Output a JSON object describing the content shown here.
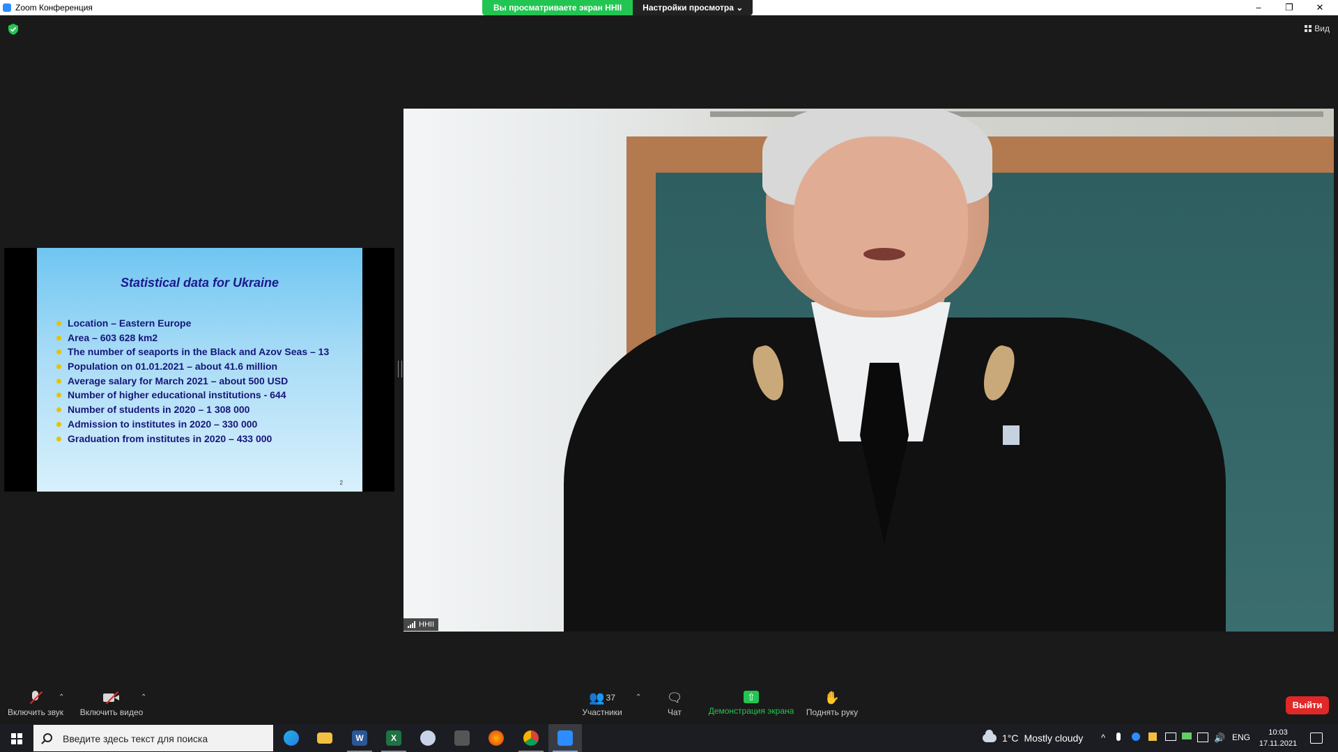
{
  "window": {
    "title": "Zoom Конференция",
    "share_banner": "Вы просматриваете экран HHII",
    "view_settings": "Настройки просмотра",
    "view_settings_chevron": "⌄",
    "minimize": "–",
    "restore": "❐",
    "close": "✕"
  },
  "meeting": {
    "view_button": "Вид"
  },
  "slide": {
    "title": "Statistical data for Ukraine",
    "bullets": [
      "Location – Eastern Europe",
      "Area – 603 628 km2",
      "The number of seaports in the Black and Azov Seas – 13",
      "Population on 01.01.2021 – about 41.6 million",
      "Average salary for March 2021 – about 500 USD",
      "Number of higher educational institutions - 644",
      "Number of students  in 2020 – 1 308 000",
      "Admission to institutes in 2020 – 330 000",
      "Graduation from institutes in 2020 – 433 000"
    ],
    "page_number": "2"
  },
  "video": {
    "participant_name": "HHII"
  },
  "toolbar": {
    "unmute_label": "Включить звук",
    "start_video_label": "Включить видео",
    "participants_label": "Участники",
    "participants_count": "37",
    "chat_label": "Чат",
    "share_label": "Демонстрация экрана",
    "raise_hand_label": "Поднять руку",
    "leave_label": "Выйти",
    "caret": "⌃"
  },
  "taskbar": {
    "search_placeholder": "Введите здесь текст для поиска",
    "weather_temp": "1°C",
    "weather_text": "Mostly cloudy",
    "language": "ENG",
    "time": "10:03",
    "date": "17.11.2021",
    "tray_chevron": "^"
  },
  "colors": {
    "accent_green": "#23c552",
    "leave_red": "#e02828",
    "slide_title": "#1a1a8c"
  }
}
